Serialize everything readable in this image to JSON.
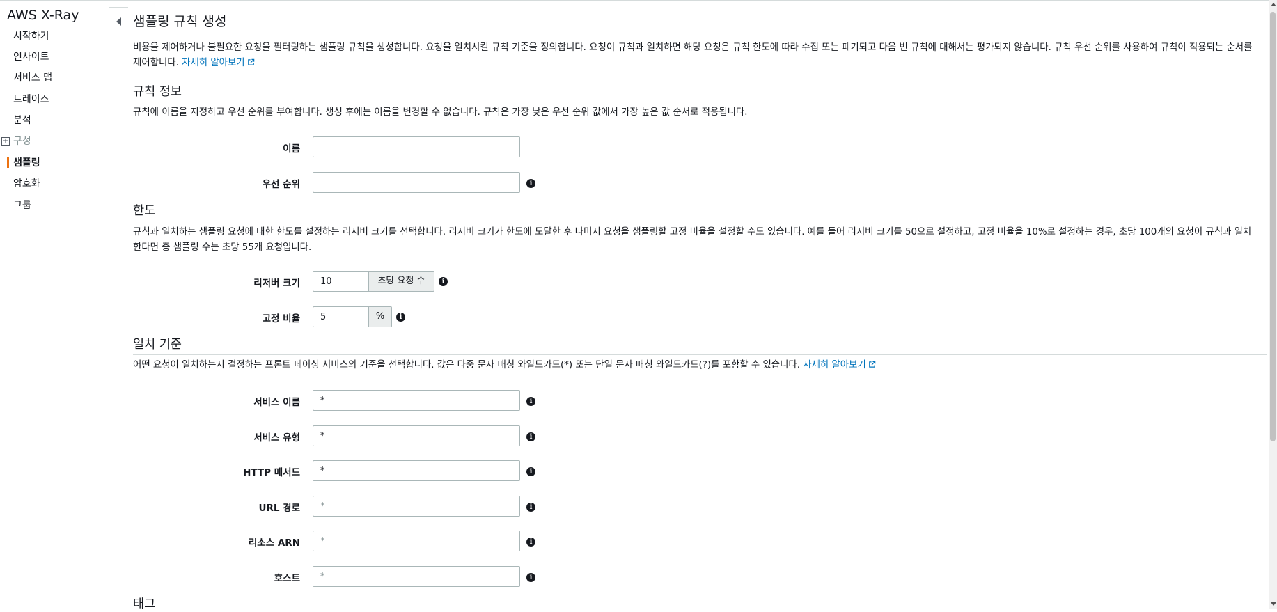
{
  "sidebar": {
    "brand": "AWS X-Ray",
    "items": [
      {
        "label": "시작하기"
      },
      {
        "label": "인사이트"
      },
      {
        "label": "서비스 맵"
      },
      {
        "label": "트레이스"
      },
      {
        "label": "분석"
      },
      {
        "label": "구성"
      },
      {
        "label": "샘플링"
      },
      {
        "label": "암호화"
      },
      {
        "label": "그룹"
      }
    ],
    "active_color": "#ec7211"
  },
  "page": {
    "title": "샘플링 규칙 생성",
    "intro_text": "비용을 제어하거나 불필요한 요청을 필터링하는 샘플링 규칙을 생성합니다. 요청을 일치시킬 규칙 기준을 정의합니다. 요청이 규칙과 일치하면 해당 요청은 규칙 한도에 따라 수집 또는 폐기되고 다음 번 규칙에 대해서는 평가되지 않습니다. 규칙 우선 순위를 사용하여 규칙이 적용되는 순서를 제어합니다.",
    "learn_more": "자세히 알아보기"
  },
  "rule_info": {
    "title": "규칙 정보",
    "description": "규칙에 이름을 지정하고 우선 순위를 부여합니다. 생성 후에는 이름을 변경할 수 없습니다. 규칙은 가장 낮은 우선 순위 값에서 가장 높은 값 순서로 적용됩니다.",
    "name_label": "이름",
    "name_value": "",
    "priority_label": "우선 순위",
    "priority_value": ""
  },
  "limits": {
    "title": "한도",
    "description": "규칙과 일치하는 샘플링 요청에 대한 한도를 설정하는 리저버 크기를 선택합니다. 리저버 크기가 한도에 도달한 후 나머지 요청을 샘플링할 고정 비율을 설정할 수도 있습니다. 예를 들어 리저버 크기를 50으로 설정하고, 고정 비율을 10%로 설정하는 경우, 초당 100개의 요청이 규칙과 일치한다면 총 샘플링 수는 초당 55개 요청입니다.",
    "reservoir_label": "리저버 크기",
    "reservoir_value": "10",
    "reservoir_unit": "초당 요청 수",
    "rate_label": "고정 비율",
    "rate_value": "5",
    "rate_unit": "%"
  },
  "criteria": {
    "title": "일치 기준",
    "description": "어떤 요청이 일치하는지 결정하는 프론트 페이싱 서비스의 기준을 선택합니다. 값은 다중 문자 매칭 와일드카드(*) 또는 단일 문자 매칭 와일드카드(?)를 포함할 수 있습니다.",
    "learn_more": "자세히 알아보기",
    "fields": [
      {
        "label": "서비스 이름",
        "value": "*",
        "placeholder": ""
      },
      {
        "label": "서비스 유형",
        "value": "*",
        "placeholder": ""
      },
      {
        "label": "HTTP 메서드",
        "value": "*",
        "placeholder": ""
      },
      {
        "label": "URL 경로",
        "value": "",
        "placeholder": "*"
      },
      {
        "label": "리소스 ARN",
        "value": "",
        "placeholder": "*"
      },
      {
        "label": "호스트",
        "value": "",
        "placeholder": "*"
      }
    ]
  },
  "tags": {
    "title": "태그"
  },
  "colors": {
    "link": "#0073bb",
    "accent": "#ec7211",
    "text": "#16191f",
    "input_border": "#aab7b8"
  }
}
